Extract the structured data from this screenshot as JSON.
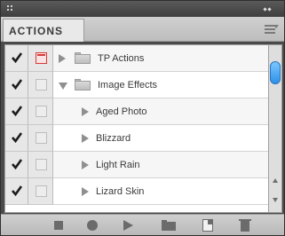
{
  "panel": {
    "tab_label": "ACTIONS"
  },
  "actions": [
    {
      "label": "TP Actions",
      "type": "set",
      "expanded": false,
      "checked": true,
      "dialog": true
    },
    {
      "label": "Image Effects",
      "type": "set",
      "expanded": true,
      "checked": true,
      "dialog": false
    },
    {
      "label": "Aged Photo",
      "type": "action",
      "expanded": false,
      "checked": true,
      "dialog": false
    },
    {
      "label": "Blizzard",
      "type": "action",
      "expanded": false,
      "checked": true,
      "dialog": false
    },
    {
      "label": "Light Rain",
      "type": "action",
      "expanded": false,
      "checked": true,
      "dialog": false
    },
    {
      "label": "Lizard Skin",
      "type": "action",
      "expanded": false,
      "checked": true,
      "dialog": false
    }
  ],
  "icons": {
    "check": "checkmark-icon",
    "dialog": "dialog-toggle-icon",
    "expand": "disclosure-triangle-icon",
    "folder": "folder-icon",
    "stop": "stop-icon",
    "record": "record-icon",
    "play": "play-icon",
    "new_set": "new-set-icon",
    "new_action": "new-action-icon",
    "delete": "trash-icon"
  },
  "colors": {
    "dialog_accent": "#d53a3a",
    "scroll_thumb": "#2f8fe8"
  }
}
